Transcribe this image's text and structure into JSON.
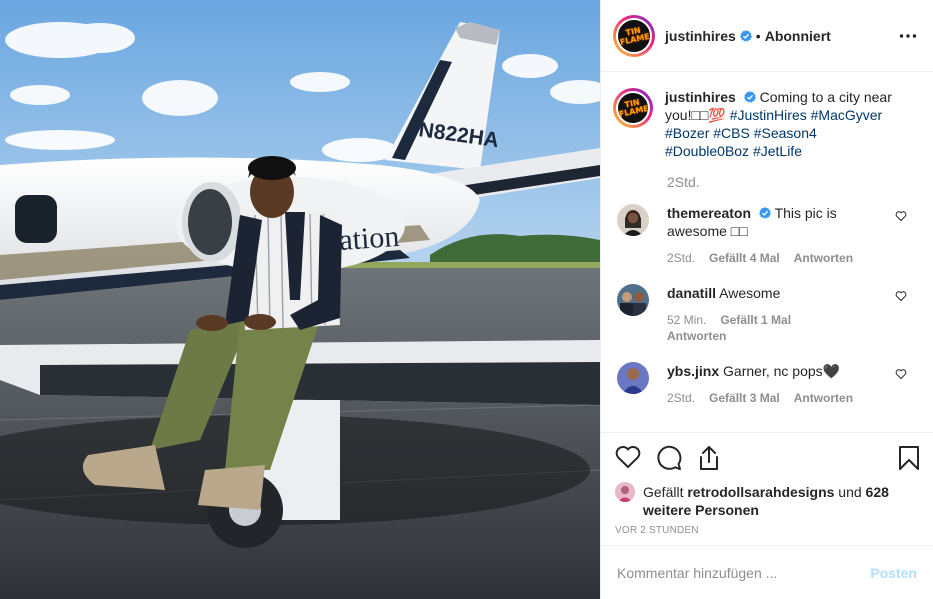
{
  "post": {
    "username": "justinhires",
    "follow_state": "Abonniert",
    "separator": "•",
    "photo_tail_number": "N822HA",
    "photo_fuselage_text": "ation"
  },
  "caption": {
    "username": "justinhires",
    "text": "Coming to a city near you!□□💯 ",
    "hashtags": [
      "#JustinHires",
      "#MacGyver",
      "#Bozer",
      "#CBS",
      "#Season4",
      "#Double0Boz",
      "#JetLife"
    ],
    "time": "2Std."
  },
  "comments": [
    {
      "username": "themereaton",
      "verified": true,
      "text": "This pic is awesome □□",
      "time": "2Std.",
      "likes": "Gefällt 4 Mal",
      "reply": "Antworten"
    },
    {
      "username": "danatill",
      "verified": false,
      "text": "Awesome",
      "time": "52 Min.",
      "likes": "Gefällt 1 Mal",
      "reply": "Antworten"
    },
    {
      "username": "ybs.jinx",
      "verified": false,
      "text": "Garner, nc pops🖤",
      "time": "2Std.",
      "likes": "Gefällt 3 Mal",
      "reply": "Antworten"
    }
  ],
  "likes": {
    "prefix": "Gefällt ",
    "user": "retrodollsarahdesigns",
    "middle": " und ",
    "others": "628 weitere Personen"
  },
  "timestamp": "VOR 2 STUNDEN",
  "add_comment": {
    "placeholder": "Kommentar hinzufügen ...",
    "post_label": "Posten"
  },
  "colors": {
    "link": "#00376b",
    "muted": "#8e8e8e",
    "verified": "#3897f0",
    "post_disabled": "#b2dffc"
  },
  "icons": [
    "verified-badge-icon",
    "more-options-icon",
    "heart-icon",
    "comment-icon",
    "share-icon",
    "bookmark-icon"
  ]
}
